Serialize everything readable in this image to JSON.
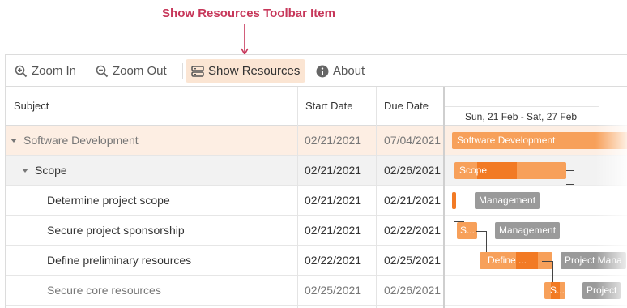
{
  "annotation": {
    "title": "Show Resources Toolbar Item"
  },
  "toolbar": {
    "zoom_in": "Zoom In",
    "zoom_out": "Zoom Out",
    "show_resources": "Show Resources",
    "about": "About"
  },
  "grid": {
    "columns": {
      "subject": "Subject",
      "start": "Start Date",
      "due": "Due Date"
    },
    "rows": [
      {
        "subject": "Software Development",
        "start": "02/21/2021",
        "due": "07/04/2021"
      },
      {
        "subject": "Scope",
        "start": "02/21/2021",
        "due": "02/26/2021"
      },
      {
        "subject": "Determine project scope",
        "start": "02/21/2021",
        "due": "02/21/2021"
      },
      {
        "subject": "Secure project sponsorship",
        "start": "02/21/2021",
        "due": "02/22/2021"
      },
      {
        "subject": "Define preliminary resources",
        "start": "02/22/2021",
        "due": "02/25/2021"
      },
      {
        "subject": "Secure core resources",
        "start": "02/25/2021",
        "due": "02/26/2021"
      }
    ]
  },
  "chart": {
    "week_label": "Sun, 21 Feb - Sat, 27 Feb",
    "tasks": [
      {
        "label": "Software Development",
        "resource": "",
        "progress": 0
      },
      {
        "label": "Scope",
        "resource": "",
        "progress": 0.6
      },
      {
        "label": "",
        "resource": "Management",
        "progress": 0
      },
      {
        "label": "S...",
        "resource": "Management",
        "progress": 0
      },
      {
        "label": "Define ...",
        "resource": "Project Mana",
        "progress": 0.5
      },
      {
        "label": "S...",
        "resource": "Project",
        "progress": 0.7
      }
    ]
  },
  "colors": {
    "accent": "#c7375a",
    "bar": "#f7a05a",
    "bar_progress": "#f27a24",
    "resource_tag": "#9a9a9a",
    "selected_row": "#fdeee3",
    "active_toolbar": "#fbe5d3"
  }
}
